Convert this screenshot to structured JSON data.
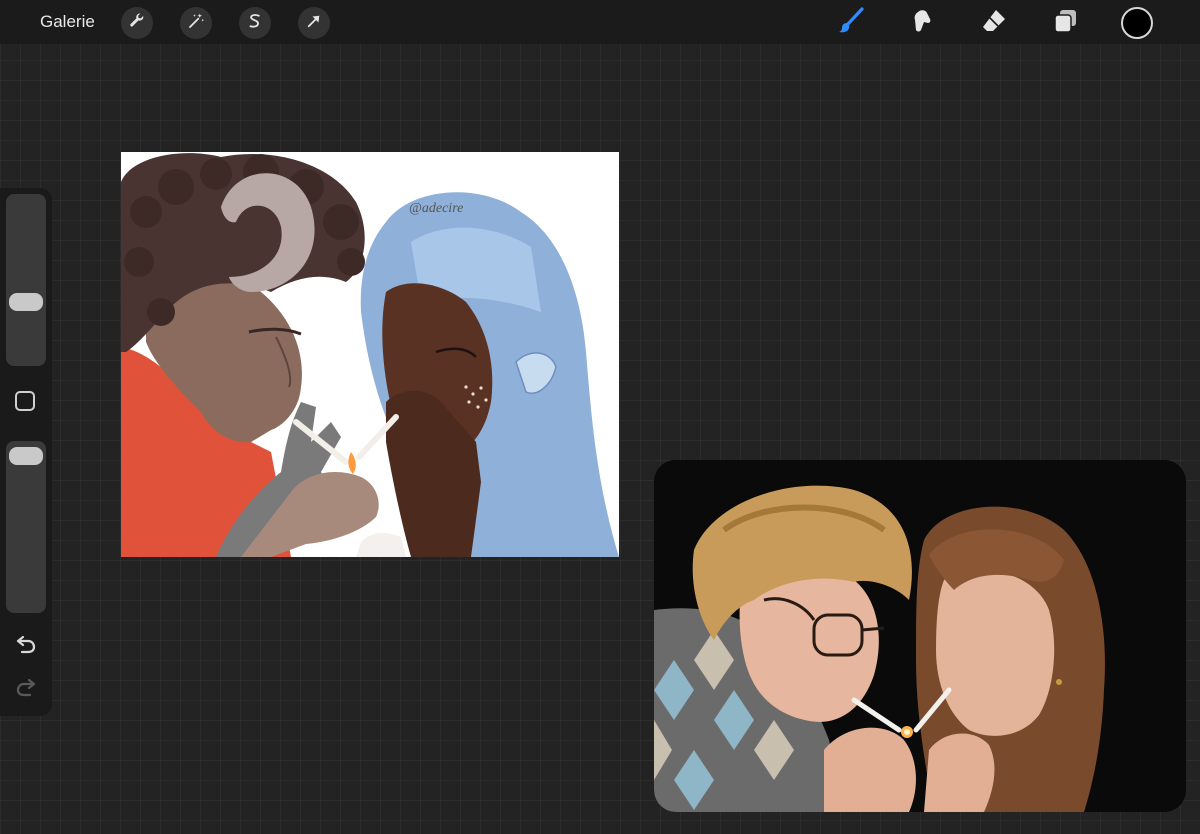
{
  "toolbar": {
    "gallery_label": "Galerie",
    "left_tools": [
      {
        "icon": "wrench-icon",
        "name": "actions"
      },
      {
        "icon": "magic-wand-icon",
        "name": "adjustments"
      },
      {
        "icon": "selection-s-icon",
        "name": "selection"
      },
      {
        "icon": "arrow-cursor-icon",
        "name": "transform"
      }
    ],
    "right_tools": [
      {
        "icon": "brush-icon",
        "name": "paint",
        "active": true
      },
      {
        "icon": "smudge-icon",
        "name": "smudge"
      },
      {
        "icon": "eraser-icon",
        "name": "eraser"
      },
      {
        "icon": "layers-icon",
        "name": "layers"
      }
    ],
    "accent_color": "#2f8cff",
    "current_color": "#000000"
  },
  "sidebar": {
    "brush_size_icon": "brush-size-slider",
    "opacity_icon": "opacity-slider",
    "modify_icon": "square-icon",
    "undo_icon": "undo-icon",
    "redo_icon": "redo-icon"
  },
  "canvas": {
    "signature_text": "@adecire"
  },
  "reference": {
    "handle_icon": "drag-handle-icon"
  }
}
